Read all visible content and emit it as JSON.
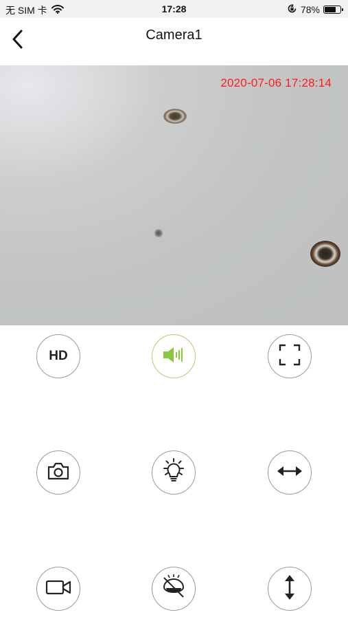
{
  "status_bar": {
    "carrier": "无 SIM 卡",
    "time": "17:28",
    "battery_percent": "78%",
    "battery_level": 0.78,
    "icons": [
      "wifi-icon",
      "orientation-lock-icon",
      "battery-icon"
    ]
  },
  "nav": {
    "title": "Camera1",
    "back_icon": "chevron-left-icon"
  },
  "video": {
    "timestamp": "2020-07-06 17:28:14",
    "timestamp_color": "#ff1a1a"
  },
  "controls": {
    "hd_label": "HD",
    "active_color": "#8cc63f",
    "icon_color": "#222222",
    "buttons": [
      {
        "name": "hd-button",
        "icon": "hd-text"
      },
      {
        "name": "sound-button",
        "icon": "speaker-icon",
        "active": true
      },
      {
        "name": "fullscreen-button",
        "icon": "fullscreen-icon"
      },
      {
        "name": "snapshot-button",
        "icon": "camera-icon"
      },
      {
        "name": "light-button",
        "icon": "light-bulb-icon"
      },
      {
        "name": "horizontal-flip-button",
        "icon": "horizontal-arrows-icon"
      },
      {
        "name": "record-button",
        "icon": "video-camera-icon"
      },
      {
        "name": "night-vision-off-button",
        "icon": "night-vision-off-icon"
      },
      {
        "name": "vertical-flip-button",
        "icon": "vertical-arrows-icon"
      }
    ]
  }
}
